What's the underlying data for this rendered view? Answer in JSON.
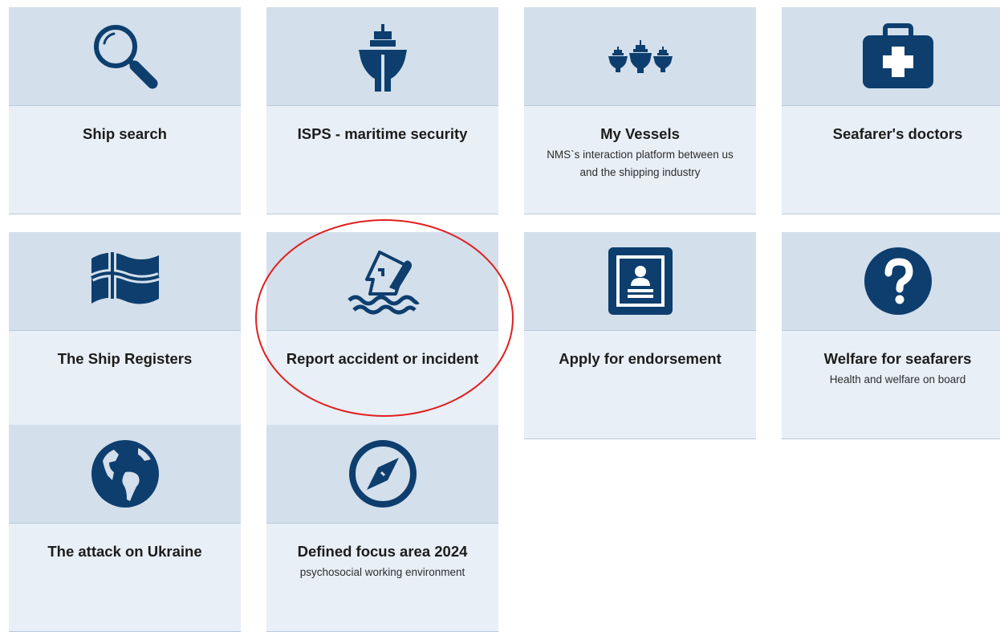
{
  "colors": {
    "icon": "#0d3e6e",
    "tile_top": "#d3dfeb",
    "tile_bottom": "#e8eff6",
    "highlight": "#e02020"
  },
  "tiles": [
    {
      "title": "Ship search",
      "subtitle": "",
      "icon": "magnifier-icon"
    },
    {
      "title": "ISPS - maritime security",
      "subtitle": "",
      "icon": "ship-bow-icon"
    },
    {
      "title": "My Vessels",
      "subtitle": "NMS`s interaction platform between us and the shipping industry",
      "icon": "three-ships-icon"
    },
    {
      "title": "Seafarer's doctors",
      "subtitle": "",
      "icon": "first-aid-kit-icon"
    },
    {
      "title": "The Ship Registers",
      "subtitle": "",
      "icon": "norwegian-flag-icon"
    },
    {
      "title": "Report accident or incident",
      "subtitle": "",
      "icon": "sinking-ship-icon"
    },
    {
      "title": "Apply for endorsement",
      "subtitle": "",
      "icon": "document-id-icon"
    },
    {
      "title": "Welfare for seafarers",
      "subtitle": "Health and welfare on board",
      "icon": "question-circle-icon"
    },
    {
      "title": "The attack on Ukraine",
      "subtitle": "",
      "icon": "globe-icon"
    },
    {
      "title": "Defined focus area 2024",
      "subtitle": "psychosocial working environment",
      "icon": "compass-icon"
    }
  ]
}
